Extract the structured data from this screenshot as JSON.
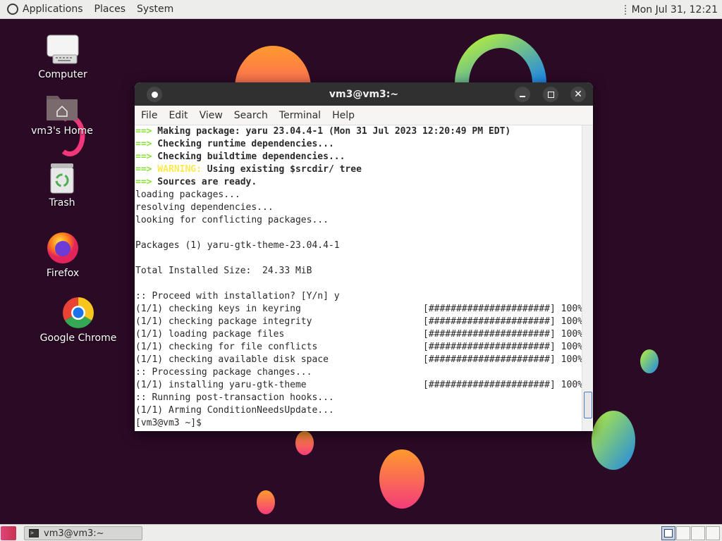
{
  "top_panel": {
    "menus": [
      "Applications",
      "Places",
      "System"
    ],
    "clock": "Mon Jul 31, 12:21"
  },
  "desktop_icons": [
    {
      "label": "Computer",
      "icon": "computer-icon"
    },
    {
      "label": "vm3's Home",
      "icon": "home-folder-icon"
    },
    {
      "label": "Trash",
      "icon": "trash-icon"
    },
    {
      "label": "Firefox",
      "icon": "firefox-icon"
    },
    {
      "label": "Google Chrome",
      "icon": "chrome-icon"
    }
  ],
  "window": {
    "title": "vm3@vm3:~",
    "menu": [
      "File",
      "Edit",
      "View",
      "Search",
      "Terminal",
      "Help"
    ],
    "colors": {
      "arrow": "#8ae234",
      "warning": "#fce94f"
    }
  },
  "terminal": {
    "lines": [
      {
        "arrow": "==>",
        "text": " Making package: yaru 23.04.4-1 (Mon 31 Jul 2023 12:20:49 PM EDT)",
        "style": "bold"
      },
      {
        "arrow": "==>",
        "text": " Checking runtime dependencies...",
        "style": "bold"
      },
      {
        "arrow": "==>",
        "text": " Checking buildtime dependencies...",
        "style": "bold"
      },
      {
        "arrow": "==>",
        "warn": " WARNING:",
        "text": " Using existing $srcdir/ tree",
        "style": "bold"
      },
      {
        "arrow": "==>",
        "text": " Sources are ready.",
        "style": "bold"
      },
      {
        "text": "loading packages..."
      },
      {
        "text": "resolving dependencies..."
      },
      {
        "text": "looking for conflicting packages..."
      },
      {
        "text": ""
      },
      {
        "text": "Packages (1) yaru-gtk-theme-23.04.4-1"
      },
      {
        "text": ""
      },
      {
        "text": "Total Installed Size:  24.33 MiB"
      },
      {
        "text": ""
      },
      {
        "text": ":: Proceed with installation? [Y/n] y"
      },
      {
        "text": "(1/1) checking keys in keyring",
        "bar": "[######################] 100%"
      },
      {
        "text": "(1/1) checking package integrity",
        "bar": "[######################] 100%"
      },
      {
        "text": "(1/1) loading package files",
        "bar": "[######################] 100%"
      },
      {
        "text": "(1/1) checking for file conflicts",
        "bar": "[######################] 100%"
      },
      {
        "text": "(1/1) checking available disk space",
        "bar": "[######################] 100%"
      },
      {
        "text": ":: Processing package changes..."
      },
      {
        "text": "(1/1) installing yaru-gtk-theme",
        "bar": "[######################] 100%"
      },
      {
        "text": ":: Running post-transaction hooks..."
      },
      {
        "text": "(1/1) Arming ConditionNeedsUpdate..."
      },
      {
        "text": "[vm3@vm3 ~]$ "
      }
    ]
  },
  "taskbar": {
    "task_label": "vm3@vm3:~"
  }
}
